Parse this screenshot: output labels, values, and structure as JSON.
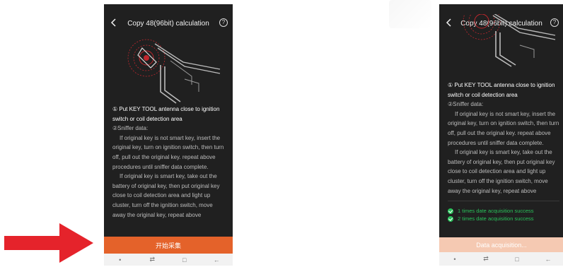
{
  "left_screen": {
    "title": "Copy 48(96bit) calculation",
    "help_glyph": "?",
    "step1": "① Put KEY TOOL antenna close to ignition switch or coil detection area",
    "step2": "②Sniffer data:",
    "para1": "If original key is not smart key, insert the original key, turn on ignition switch, then turn off, pull out the original key. repeat above procedures until sniffer data complete.",
    "para2": "If original key is smart key, take out the battery of original key, then put original key close to coil detection area and light up cluster, turn off the ignition switch, move away the original key, repeat above",
    "start_button": "开始采集"
  },
  "right_screen": {
    "title": "Copy 48(96bit) calculation",
    "help_glyph": "?",
    "step1": "① Put KEY TOOL antenna close to ignition switch or coil detection area",
    "step2": "②Sniffer data:",
    "para1": "If original key is not smart key, insert the original key, turn on ignition switch, then turn off, pull out the original key. repeat above procedures until sniffer data complete.",
    "para2": "If original key is smart key, take out the battery of original key, then put original key close to coil detection area and light up cluster, turn off the ignition switch, move away the original key, repeat above",
    "status_item_1": "1 times date acquisition success",
    "status_item_2": "2 times date acquisition success",
    "acquisition_button": "Data acquisition..."
  },
  "navbar": {
    "dot": "•",
    "recent": "⇄",
    "home": "□",
    "back": "←"
  },
  "colors": {
    "accent": "#e4622a",
    "accent_disabled": "#f5c9b2",
    "success": "#29c05a",
    "arrow": "#e5232b",
    "screen_bg": "#202020"
  }
}
